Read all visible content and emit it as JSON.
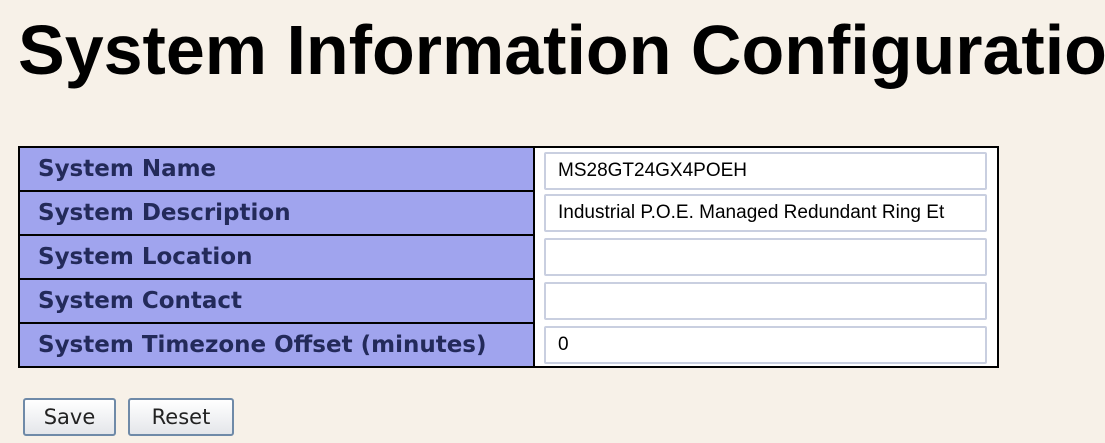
{
  "page": {
    "title": "System Information Configuration"
  },
  "form": {
    "rows": [
      {
        "label": "System Name",
        "value": "MS28GT24GX4POEH"
      },
      {
        "label": "System Description",
        "value": "Industrial P.O.E. Managed Redundant Ring Et"
      },
      {
        "label": "System Location",
        "value": ""
      },
      {
        "label": "System Contact",
        "value": ""
      },
      {
        "label": "System Timezone Offset (minutes)",
        "value": "0"
      }
    ]
  },
  "buttons": {
    "save_label": "Save",
    "reset_label": "Reset"
  },
  "colors": {
    "background": "#f7f1e8",
    "label_cell_bg": "#a0a4ee",
    "label_text": "#232a5a"
  }
}
